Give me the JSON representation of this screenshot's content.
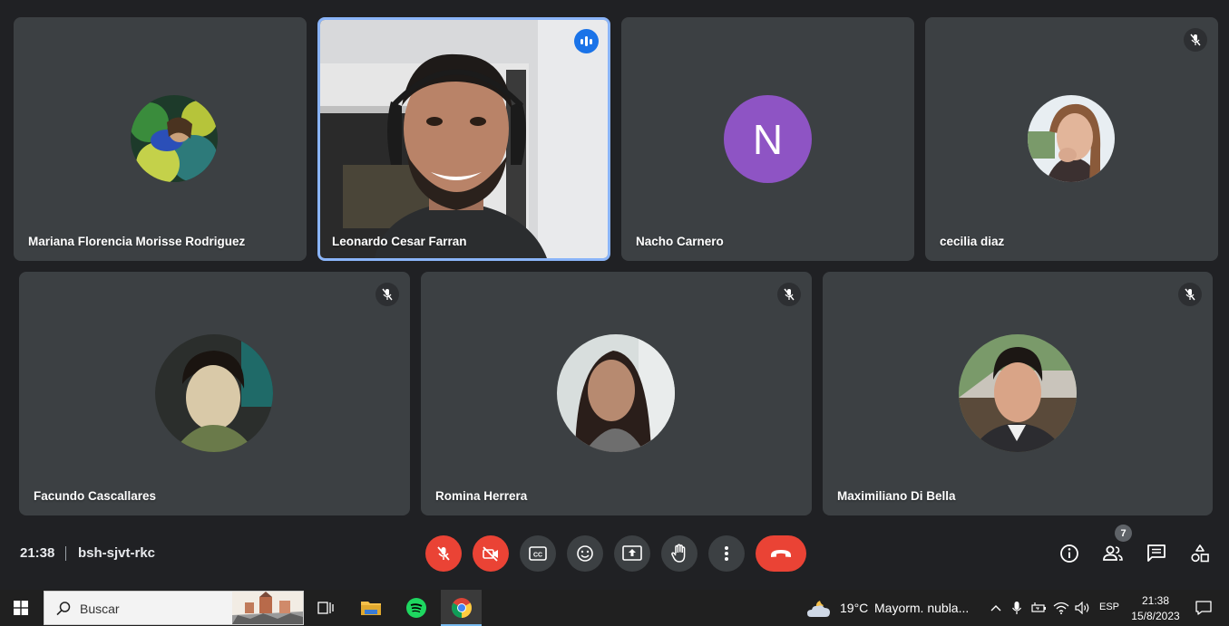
{
  "participants": [
    {
      "name": "Mariana Florencia Morisse Rodriguez",
      "muted": false
    },
    {
      "name": "Leonardo Cesar Farran",
      "speaking": true
    },
    {
      "name": "Nacho Carnero",
      "avatar_letter": "N",
      "avatar_color": "#8e54c4"
    },
    {
      "name": "cecilia diaz",
      "muted": true
    },
    {
      "name": "Facundo Cascallares",
      "muted": true
    },
    {
      "name": "Romina Herrera",
      "muted": true
    },
    {
      "name": "Maximiliano Di Bella",
      "muted": true
    }
  ],
  "meeting": {
    "time": "21:38",
    "code": "bsh-sjvt-rkc",
    "participant_count": "7"
  },
  "controls": {
    "mic": "mic-off-icon",
    "camera": "camera-off-icon",
    "captions": "closed-captions-icon",
    "reactions": "emoji-icon",
    "present": "present-screen-icon",
    "raise_hand": "raise-hand-icon",
    "more": "more-vertical-icon",
    "leave": "hang-up-icon"
  },
  "colors": {
    "background": "#202124",
    "tile": "#3c4043",
    "danger": "#ea4335",
    "active_border": "#8ab4f8",
    "speaking_badge": "#1a73e8"
  },
  "taskbar": {
    "search_label": "Buscar",
    "weather_temp": "19°C",
    "weather_text": "Mayorm. nubla...",
    "language": "ESP",
    "clock_time": "21:38",
    "clock_date": "15/8/2023"
  }
}
